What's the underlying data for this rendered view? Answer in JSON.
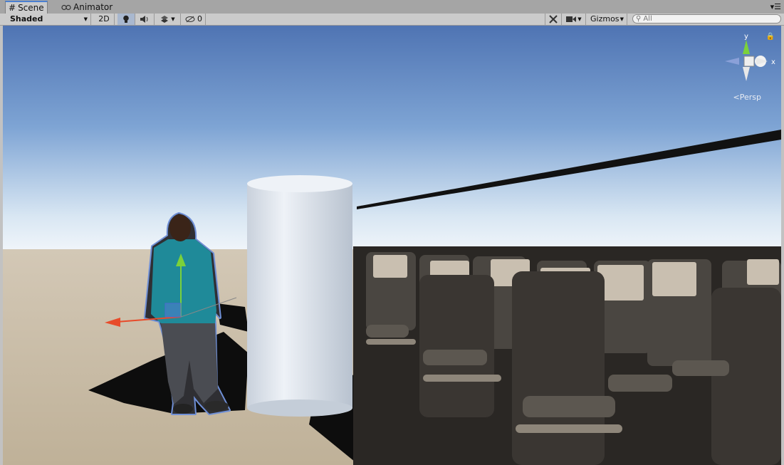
{
  "tabs": [
    {
      "label": "Scene",
      "icon": "grid-icon",
      "active": true
    },
    {
      "label": "Animator",
      "icon": "animator-icon",
      "active": false
    }
  ],
  "tab_menu_icon": "menu-icon",
  "toolbar": {
    "draw_mode": "Shaded",
    "mode_2d": "2D",
    "lighting_icon": "lightbulb-icon",
    "audio_icon": "speaker-icon",
    "effects_icon": "effects-icon",
    "hidden_count": "0",
    "tools_icon": "tools-icon",
    "camera_icon": "camera-icon",
    "gizmos": "Gizmos",
    "search_placeholder": "All"
  },
  "scene": {
    "projection_label": "Persp",
    "axis_y": "y",
    "axis_x": "x",
    "colors": {
      "sky_top": "#4f74b3",
      "sky_horizon": "#f0f5fa",
      "ground": "#c9bca6",
      "selection_outline": "#6f8fd6"
    }
  }
}
